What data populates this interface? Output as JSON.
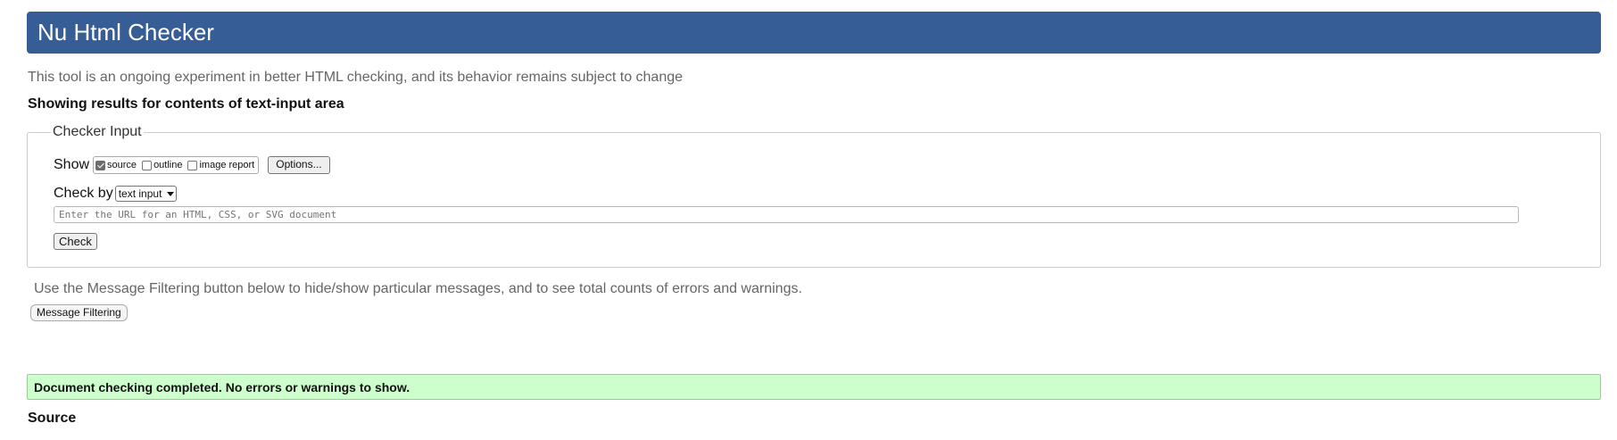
{
  "header": {
    "title": "Nu Html Checker",
    "color": "#365d95"
  },
  "intro_text": "This tool is an ongoing experiment in better HTML checking, and its behavior remains subject to change",
  "results_heading": "Showing results for contents of text-input area",
  "checker_input": {
    "legend": "Checker Input",
    "show_label": "Show",
    "checkboxes": [
      {
        "label": "source",
        "checked": true
      },
      {
        "label": "outline",
        "checked": false
      },
      {
        "label": "image report",
        "checked": false
      }
    ],
    "options_button": "Options...",
    "check_by_label": "Check by",
    "check_by_selected": "text input",
    "url_placeholder": "Enter the URL for an HTML, CSS, or SVG document",
    "check_button": "Check"
  },
  "filtering": {
    "note": "Use the Message Filtering button below to hide/show particular messages, and to see total counts of errors and warnings.",
    "button": "Message Filtering"
  },
  "status": {
    "message": "Document checking completed. No errors or warnings to show.",
    "color": "#ccffcc"
  },
  "source_heading": "Source"
}
